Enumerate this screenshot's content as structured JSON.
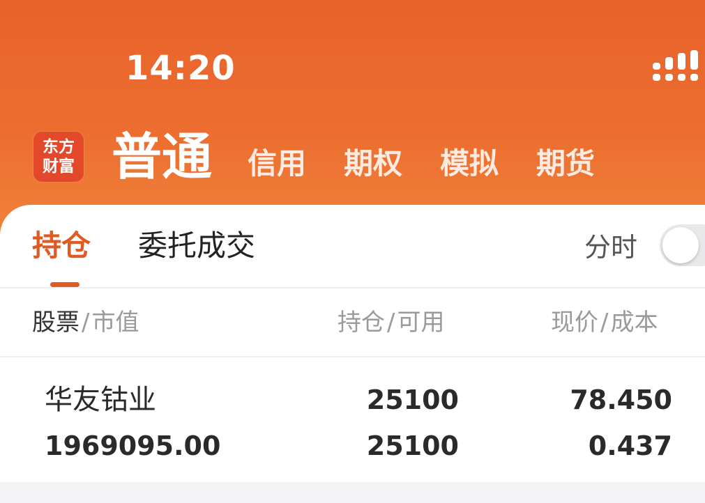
{
  "status_bar": {
    "time": "14:20"
  },
  "app": {
    "logo_line1": "东方",
    "logo_line2": "财富"
  },
  "account_tabs": [
    {
      "label": "普通",
      "active": true
    },
    {
      "label": "信用",
      "active": false
    },
    {
      "label": "期权",
      "active": false
    },
    {
      "label": "模拟",
      "active": false
    },
    {
      "label": "期货",
      "active": false
    }
  ],
  "sub_tabs": [
    {
      "label": "持仓",
      "active": true
    },
    {
      "label": "委托成交",
      "active": false
    }
  ],
  "fenshi": {
    "label": "分时",
    "on": false
  },
  "columns": {
    "stock": {
      "primary": "股票",
      "sep": "/",
      "secondary": "市值"
    },
    "position": {
      "primary": "持仓",
      "sep": "/",
      "secondary": "可用"
    },
    "price": {
      "primary": "现价",
      "sep": "/",
      "secondary": "成本"
    }
  },
  "holdings": [
    {
      "name": "华友钴业",
      "market_value": "1969095.00",
      "position": "25100",
      "available": "25100",
      "price": "78.450",
      "cost": "0.437"
    }
  ],
  "colors": {
    "brand": "#e8622c",
    "accent": "#e05a24"
  },
  "icons": [
    "signal-icon",
    "app-logo-icon"
  ]
}
